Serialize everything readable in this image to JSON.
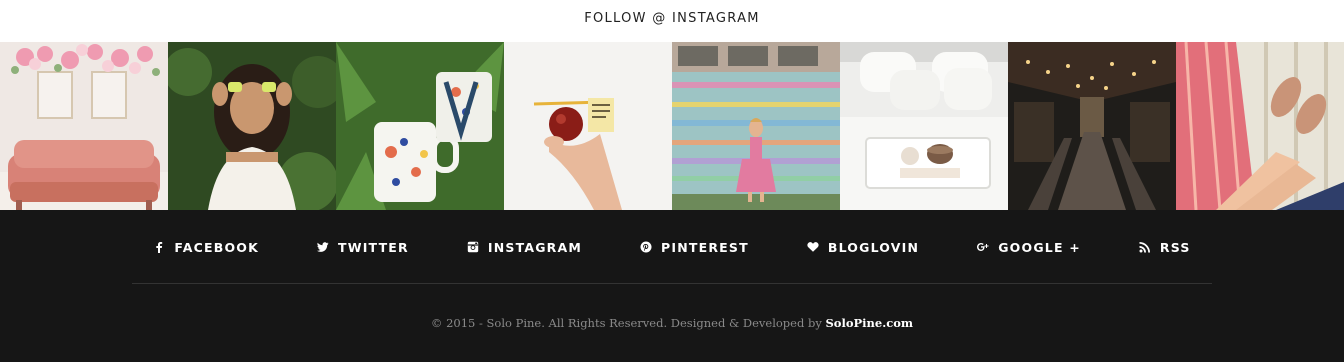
{
  "follow": {
    "title": "FOLLOW @ INSTAGRAM"
  },
  "instagram": {
    "tiles": [
      {
        "name": "pink-sofa-photo"
      },
      {
        "name": "woman-flowers-eyes-photo"
      },
      {
        "name": "floral-mugs-photo"
      },
      {
        "name": "hand-apple-pencil-photo"
      },
      {
        "name": "painted-bus-woman-photo"
      },
      {
        "name": "white-bed-tray-photo"
      },
      {
        "name": "restaurant-lights-photo"
      },
      {
        "name": "hammock-feet-photo"
      }
    ]
  },
  "footer": {
    "social": [
      {
        "label": "FACEBOOK",
        "icon": "facebook-icon"
      },
      {
        "label": "TWITTER",
        "icon": "twitter-icon"
      },
      {
        "label": "INSTAGRAM",
        "icon": "instagram-icon"
      },
      {
        "label": "PINTEREST",
        "icon": "pinterest-icon"
      },
      {
        "label": "BLOGLOVIN",
        "icon": "heart-icon"
      },
      {
        "label": "GOOGLE +",
        "icon": "google-plus-icon"
      },
      {
        "label": "RSS",
        "icon": "rss-icon"
      }
    ],
    "copyright_text": "© 2015 - Solo Pine. All Rights Reserved. Designed & Developed by ",
    "copyright_link": "SoloPine.com"
  },
  "colors": {
    "footer_bg": "#161616",
    "divider": "#333333",
    "copyright_text": "#8a8a8a"
  }
}
